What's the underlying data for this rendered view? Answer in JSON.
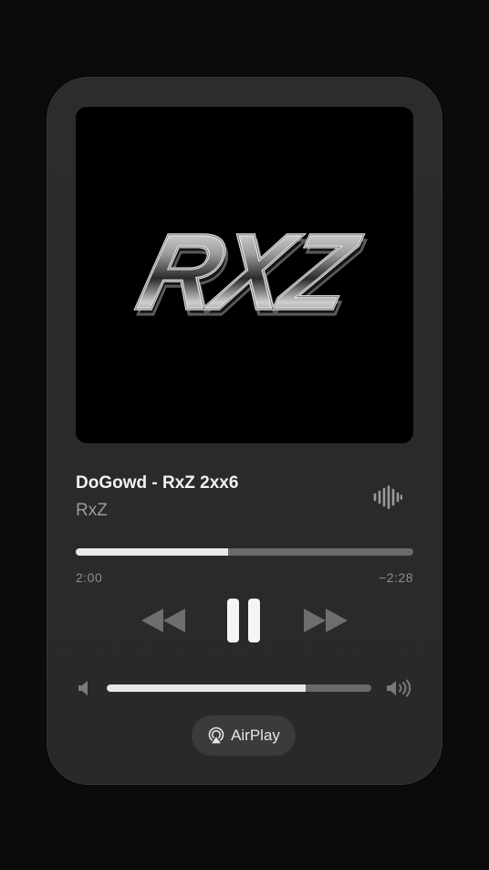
{
  "album_art": {
    "logo_text": "RxZ"
  },
  "track": {
    "title": "DoGowd - RxZ 2xx6",
    "artist": "RxZ"
  },
  "playback": {
    "progress": 0.45,
    "elapsed": "2:00",
    "remaining": "−2:28",
    "state": "playing"
  },
  "volume": {
    "level": 0.75
  },
  "airplay": {
    "label": "AirPlay"
  },
  "colors": {
    "background": "#0b0b0b",
    "card": "#2b2b2b",
    "primary_text": "#f2f2f2",
    "secondary_text": "#9a9a9a",
    "track_fill": "#e9e9e9",
    "track_bg": "#6a6a6a",
    "control": "#f5f5f5",
    "control_dim": "#6e6e6e"
  },
  "icons": {
    "wave": "audio-wave-icon",
    "rewind": "rewind-icon",
    "pause": "pause-icon",
    "forward": "fast-forward-icon",
    "volume_low": "speaker-low-icon",
    "volume_high": "speaker-high-icon",
    "airplay": "airplay-icon"
  }
}
